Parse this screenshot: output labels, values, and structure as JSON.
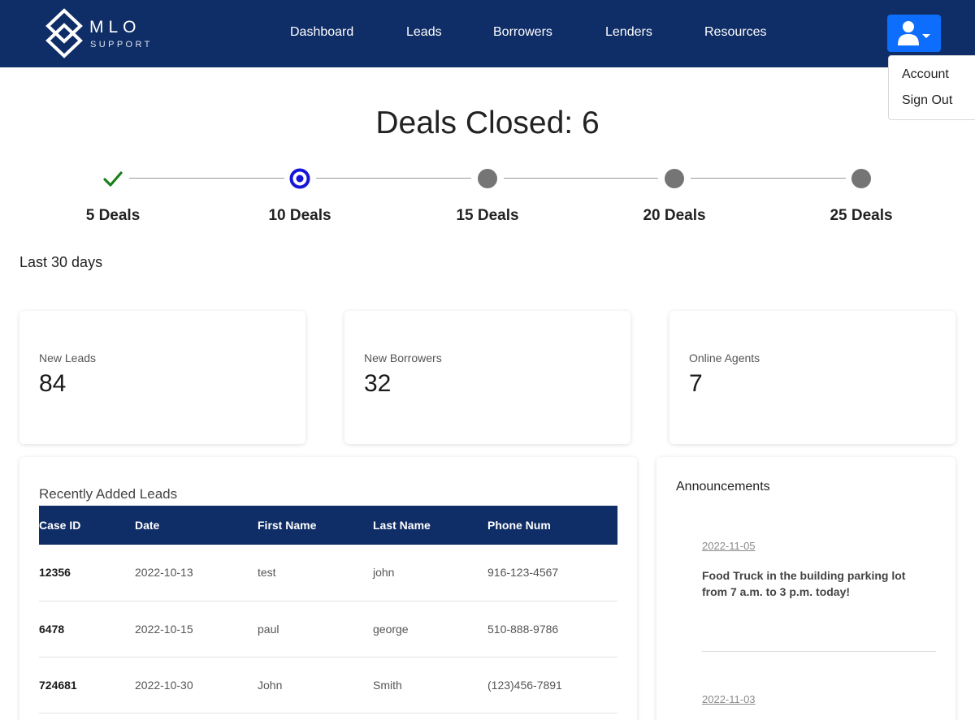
{
  "brand": {
    "name": "MLO",
    "tagline": "SUPPORT"
  },
  "nav": {
    "links": [
      {
        "label": "Dashboard"
      },
      {
        "label": "Leads"
      },
      {
        "label": "Borrowers"
      },
      {
        "label": "Lenders"
      },
      {
        "label": "Resources"
      }
    ]
  },
  "user_menu": {
    "icon": "user-icon",
    "accent_color": "#0d6efd",
    "items": [
      {
        "label": "Account"
      },
      {
        "label": "Sign Out"
      }
    ]
  },
  "colors": {
    "navbar": "#0f2d66",
    "complete": "#1a7f1a",
    "current": "#1616d9",
    "pending": "#757575"
  },
  "deals": {
    "heading": "Deals Closed: 6",
    "milestones": [
      {
        "label": "5 Deals",
        "status": "complete"
      },
      {
        "label": "10 Deals",
        "status": "current"
      },
      {
        "label": "15 Deals",
        "status": "pending"
      },
      {
        "label": "20 Deals",
        "status": "pending"
      },
      {
        "label": "25 Deals",
        "status": "pending"
      }
    ]
  },
  "period_label": "Last 30 days",
  "stats": [
    {
      "label": "New Leads",
      "value": "84"
    },
    {
      "label": "New Borrowers",
      "value": "32"
    },
    {
      "label": "Online Agents",
      "value": "7"
    }
  ],
  "leads": {
    "title": "Recently Added Leads",
    "columns": [
      "Case ID",
      "Date",
      "First Name",
      "Last Name",
      "Phone Num"
    ],
    "rows": [
      [
        "12356",
        "2022-10-13",
        "test",
        "john",
        "916-123-4567"
      ],
      [
        "6478",
        "2022-10-15",
        "paul",
        "george",
        "510-888-9786"
      ],
      [
        "724681",
        "2022-10-30",
        "John",
        "Smith",
        "(123)456-7891"
      ]
    ]
  },
  "announcements": {
    "title": "Announcements",
    "items": [
      {
        "date": "2022-11-05",
        "text": "Food Truck in the building parking lot from 7 a.m. to 3 p.m. today!"
      },
      {
        "date": "2022-11-03",
        "text": ""
      }
    ]
  }
}
